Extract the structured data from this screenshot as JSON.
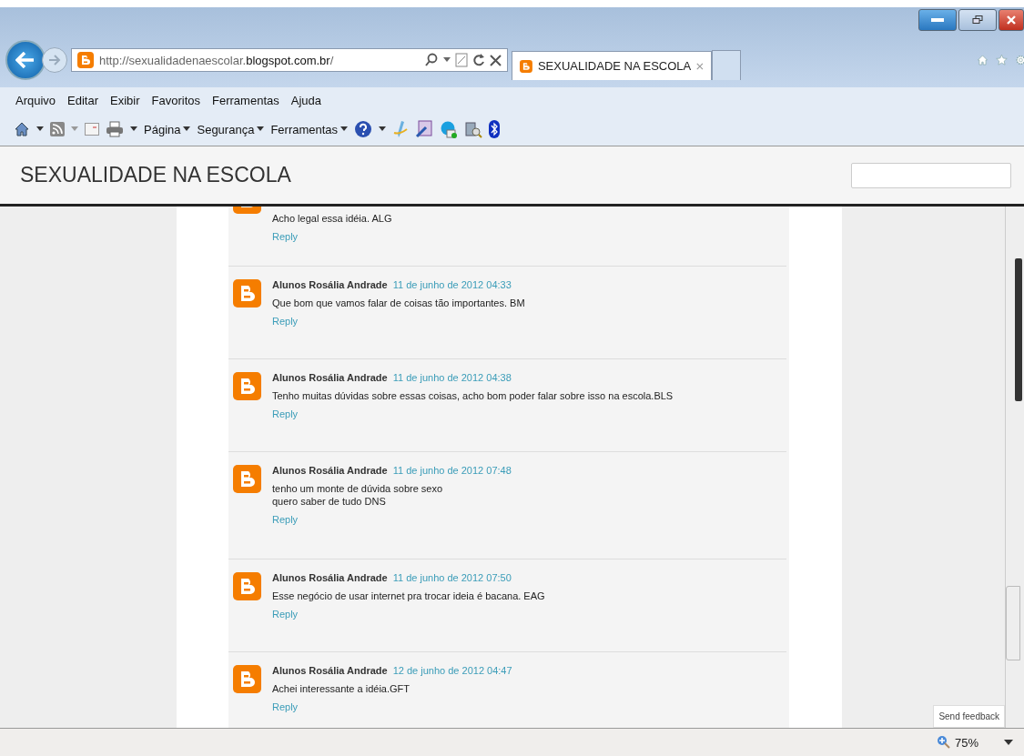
{
  "browser": {
    "address": {
      "prefix": "http://sexualidadenaescolar.",
      "domain": "blogspot.com.br",
      "suffix": "/"
    },
    "tab": {
      "title": "SEXUALIDADE NA ESCOLA",
      "selected": true
    },
    "menu": [
      "Arquivo",
      "Editar",
      "Exibir",
      "Favoritos",
      "Ferramentas",
      "Ajuda"
    ],
    "commands": [
      "Página",
      "Segurança",
      "Ferramentas"
    ],
    "zoom": "75%"
  },
  "blog": {
    "title": "SEXUALIDADE NA ESCOLA"
  },
  "comments": [
    {
      "kind": "partial",
      "lines": [
        "Acho legal essa idéia. ALG"
      ],
      "reply": "Reply"
    },
    {
      "kind": "full",
      "author": "Alunos Rosália Andrade",
      "date": "11 de junho de 2012 04:33",
      "lines": [
        "Que bom que vamos falar de coisas tão importantes. BM"
      ],
      "reply": "Reply"
    },
    {
      "kind": "full",
      "author": "Alunos Rosália Andrade",
      "date": "11 de junho de 2012 04:38",
      "lines": [
        "Tenho muitas dúvidas sobre essas coisas, acho bom poder falar sobre isso na escola.BLS"
      ],
      "reply": "Reply"
    },
    {
      "kind": "full",
      "author": "Alunos Rosália Andrade",
      "date": "11 de junho de 2012 07:48",
      "lines": [
        "tenho um monte de dúvida sobre sexo",
        "quero saber de tudo DNS"
      ],
      "reply": "Reply"
    },
    {
      "kind": "full",
      "author": "Alunos Rosália Andrade",
      "date": "11 de junho de 2012 07:50",
      "lines": [
        "Esse negócio de usar internet pra trocar ideia é bacana. EAG"
      ],
      "reply": "Reply"
    },
    {
      "kind": "full",
      "author": "Alunos Rosália Andrade",
      "date": "12 de junho de 2012 04:47",
      "lines": [
        "Achei interessante a idéia.GFT"
      ],
      "reply": "Reply"
    }
  ],
  "feedback": "Send feedback"
}
